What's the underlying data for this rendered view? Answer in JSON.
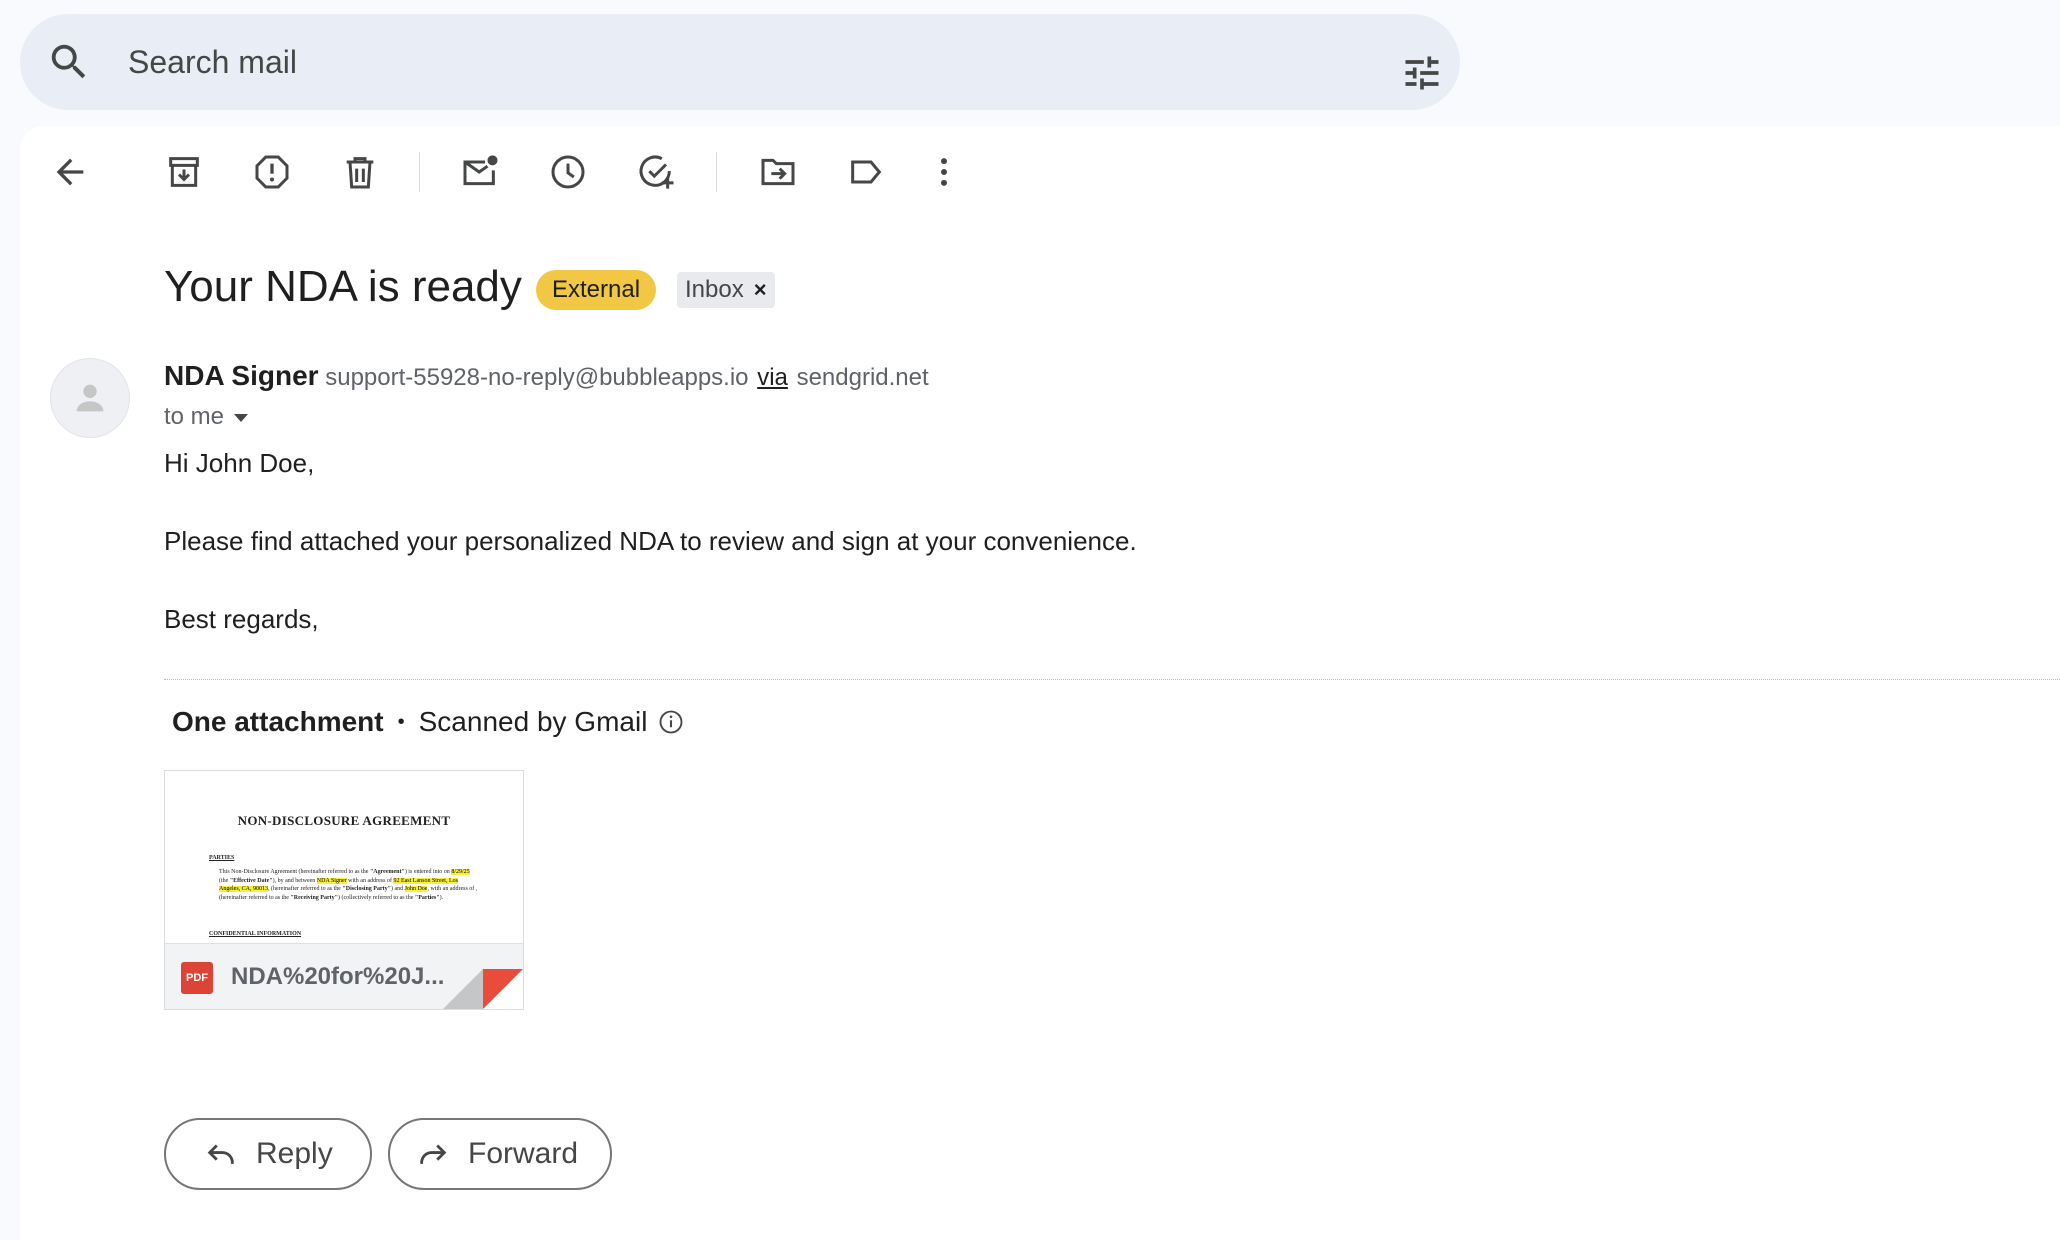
{
  "search": {
    "placeholder": "Search mail",
    "search_icon": "search-icon",
    "options_icon": "tune-icon"
  },
  "toolbar": {
    "icons": [
      "back-arrow-icon",
      "archive-icon",
      "report-spam-icon",
      "delete-icon",
      "mark-unread-icon",
      "snooze-icon",
      "add-task-icon",
      "move-to-icon",
      "label-icon",
      "more-vert-icon"
    ]
  },
  "email": {
    "subject": "Your NDA is ready",
    "labels": {
      "external": "External",
      "inbox": "Inbox",
      "inbox_remove": "×"
    },
    "sender": {
      "name": "NDA Signer",
      "address": "support-55928-no-reply@bubbleapps.io",
      "via_word": "via",
      "via_domain": "sendgrid.net"
    },
    "recipient_label": "to me",
    "body": {
      "greeting": "Hi John Doe,",
      "line1": "Please find attached your personalized NDA to review and sign at your convenience.",
      "closing": "Best regards,"
    }
  },
  "attachments": {
    "heading": "One attachment",
    "bullet": "•",
    "scanned": "Scanned by Gmail",
    "file": {
      "name": "NDA%20for%20J...",
      "type_badge": "PDF",
      "preview": {
        "title": "NON-DISCLOSURE AGREEMENT",
        "section1": "PARTIES",
        "text_a": "This Non-Disclosure Agreement (hereinafter referred to as the ",
        "agreement": "\"Agreement\"",
        "text_b": ") is entered into on ",
        "date": "8/29/25",
        "text_c": " (the ",
        "effective": "\"Effective Date\"",
        "text_d": "), by and between ",
        "party1": "NDA Signer",
        "text_e": " with an address of ",
        "address": "92 East Lanson Street, Los Angeles, CA, 90013",
        "text_f": ", (hereinafter referred to as the ",
        "disclosing": "\"Disclosing Party\"",
        "text_g": ") and ",
        "party2": "John Doe",
        "text_h": ", with an address of , (hereinafter referred to as the ",
        "receiving": "\"Receiving Party\"",
        "text_i": ") (collectively referred to as the ",
        "parties": "\"Parties\"",
        "text_j": ").",
        "section2": "CONFIDENTIAL INFORMATION"
      }
    }
  },
  "actions": {
    "reply": "Reply",
    "forward": "Forward"
  }
}
